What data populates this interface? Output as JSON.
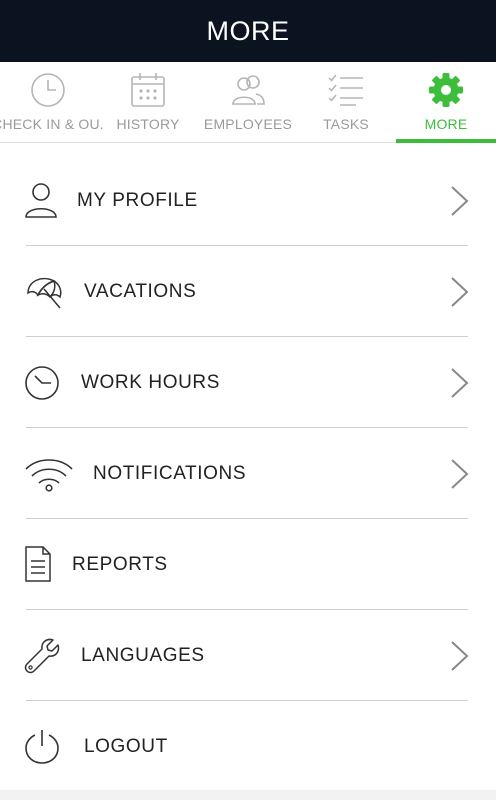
{
  "header": {
    "title": "MORE"
  },
  "tabs": [
    {
      "label": "CHECK IN & OU.",
      "icon": "clock-icon"
    },
    {
      "label": "HISTORY",
      "icon": "calendar-icon"
    },
    {
      "label": "EMPLOYEES",
      "icon": "users-icon"
    },
    {
      "label": "TASKS",
      "icon": "checklist-icon"
    },
    {
      "label": "MORE",
      "icon": "gear-icon",
      "active": true
    }
  ],
  "menu": [
    {
      "label": "MY PROFILE",
      "icon": "user-icon",
      "has_chevron": true
    },
    {
      "label": "VACATIONS",
      "icon": "umbrella-icon",
      "has_chevron": true
    },
    {
      "label": "WORK HOURS",
      "icon": "clock-icon",
      "has_chevron": true
    },
    {
      "label": "NOTIFICATIONS",
      "icon": "wifi-icon",
      "has_chevron": true
    },
    {
      "label": "REPORTS",
      "icon": "document-icon",
      "has_chevron": false
    },
    {
      "label": "LANGUAGES",
      "icon": "wrench-icon",
      "has_chevron": true
    },
    {
      "label": "LOGOUT",
      "icon": "power-icon",
      "has_chevron": false
    }
  ],
  "colors": {
    "header_bg": "#0b1320",
    "active_tab": "#3cbe3c",
    "history_tab": "#e3a52a",
    "inactive_tab": "#9a9a9a"
  }
}
